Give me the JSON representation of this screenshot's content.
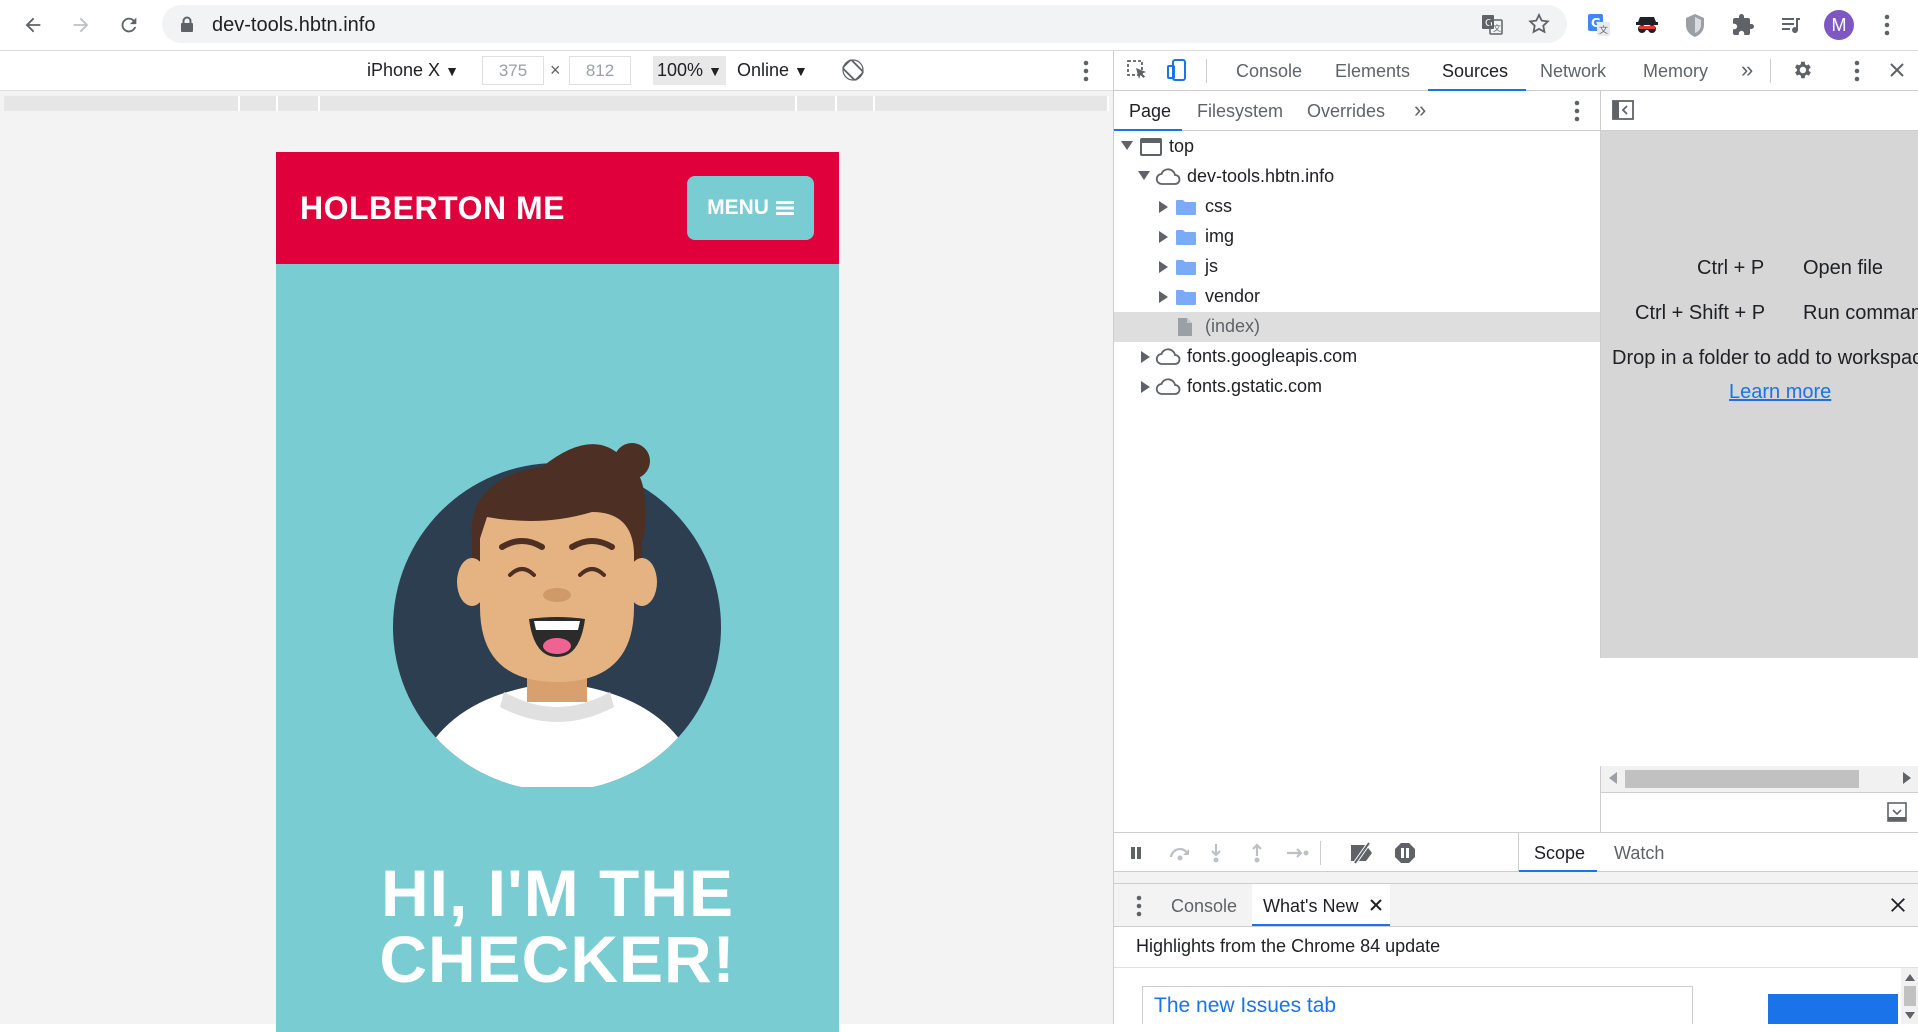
{
  "browser": {
    "url": "dev-tools.hbtn.info",
    "avatar_letter": "M",
    "colors": {
      "avatar": "#7e57c2",
      "accent": "#1a73e8"
    }
  },
  "device_toolbar": {
    "device": "iPhone X",
    "width": "375",
    "times": "×",
    "height": "812",
    "zoom": "100%",
    "network": "Online"
  },
  "page": {
    "brand": "HOLBERTON ME",
    "menu_label": "MENU",
    "hero_line1": "HI, I'M THE",
    "hero_line2": "CHECKER!",
    "colors": {
      "header": "#e0003c",
      "background": "#79ccd2"
    }
  },
  "devtools": {
    "tabs": [
      "Console",
      "Elements",
      "Sources",
      "Network",
      "Memory"
    ],
    "active_tab": "Sources",
    "sub_tabs": [
      "Page",
      "Filesystem",
      "Overrides"
    ],
    "tree": {
      "top": "top",
      "host": "dev-tools.hbtn.info",
      "folders": [
        "css",
        "img",
        "js",
        "vendor"
      ],
      "index": "(index)",
      "fonts1": "fonts.googleapis.com",
      "fonts2": "fonts.gstatic.com"
    },
    "shortcuts": {
      "open_keys": "Ctrl + P",
      "open_label": "Open file",
      "run_keys": "Ctrl + Shift + P",
      "run_label": "Run command",
      "drop_text": "Drop in a folder to add to workspace",
      "learn_more": "Learn more"
    },
    "debug_tabs": {
      "scope": "Scope",
      "watch": "Watch"
    },
    "drawer": {
      "console": "Console",
      "whats_new": "What's New",
      "highlights": "Highlights from the Chrome 84 update",
      "issue_title": "The new Issues tab"
    }
  }
}
